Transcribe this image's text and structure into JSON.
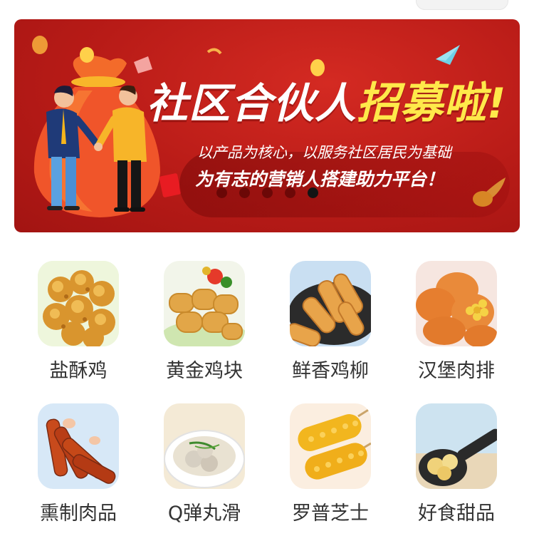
{
  "banner": {
    "title_main": "社区合伙人",
    "title_highlight": "招募啦",
    "title_exclaim": "!",
    "slogan_line1": "以产品为核心，以服务社区居民为基础",
    "slogan_line2": "为有志的营销人搭建助力平台！",
    "active_slide": 5,
    "slide_count": 5,
    "colors": {
      "background": "#b81b17",
      "highlight": "#ffe94a"
    }
  },
  "categories": [
    {
      "label": "盐酥鸡",
      "icon": "popcorn-chicken-image"
    },
    {
      "label": "黄金鸡块",
      "icon": "chicken-nuggets-image"
    },
    {
      "label": "鲜香鸡柳",
      "icon": "chicken-strips-image"
    },
    {
      "label": "汉堡肉排",
      "icon": "burger-patty-image"
    },
    {
      "label": "熏制肉品",
      "icon": "smoked-sausage-image"
    },
    {
      "label": "Q弹丸滑",
      "icon": "meatball-soup-image"
    },
    {
      "label": "罗普芝士",
      "icon": "corn-dog-image"
    },
    {
      "label": "好食甜品",
      "icon": "dessert-spoon-image"
    }
  ]
}
